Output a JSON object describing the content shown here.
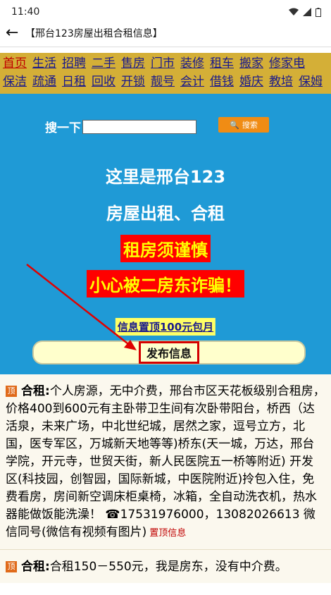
{
  "status": {
    "time": "11:40"
  },
  "titlebar": {
    "title": "【邢台123房屋出租合租信息】"
  },
  "nav": {
    "items": [
      "首页",
      "生活",
      "招聘",
      "二手",
      "售房",
      "门市",
      "装修",
      "租车",
      "搬家",
      "修家电",
      "保洁",
      "疏通",
      "日租",
      "回收",
      "开锁",
      "靓号",
      "会计",
      "借钱",
      "婚庆",
      "教培",
      "保姆"
    ]
  },
  "hero": {
    "search_label": "搜一下",
    "search_button": "搜索",
    "line1": "这里是邢台123",
    "line2": "房屋出租、合租",
    "warn1": "租房须谨慎",
    "warn2": "小心被二房东诈骗！",
    "promo": "信息置顶100元包月",
    "publish": "发布信息"
  },
  "listings": [
    {
      "pin": "顶",
      "kind": "合租:",
      "text": "个人房源，无中介费，邢台市区天花板级别合租房，价格400到600元有主卧带卫生间有次卧带阳台，桥西（达活泉，未来广场，中北世纪城，居然之家，逗号立方，北国，医专军区，万城新天地等等)桥东(天一城，万达，邢台学院，开元寺，世贸天街，新人民医院五一桥等附近) 开发区(科技园，创智园，国际新城，中医院附近)拎包入住，免费看房，房间新空调床柜桌椅，冰箱，全自动洗衣机，热水器能做饭能洗澡！ ☎17531976000，13082026613 微信同号(微信有视频有图片)",
      "top_link": "置顶信息"
    },
    {
      "pin": "顶",
      "kind": "合租:",
      "text": "合租150－550元，我是房东，没有中介费。",
      "top_link": ""
    }
  ]
}
